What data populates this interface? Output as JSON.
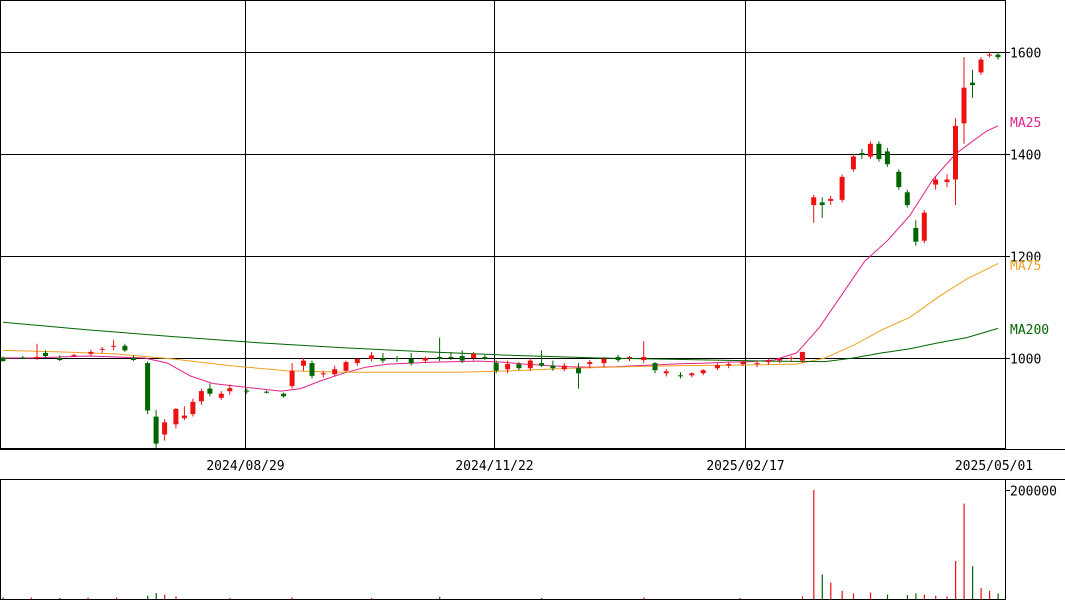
{
  "chart_data": {
    "type": "candlestick",
    "x_axis": {
      "labels": [
        "2024/08/29",
        "2024/11/22",
        "2025/02/17",
        "2025/05/01"
      ]
    },
    "price_axis": {
      "ticks": [
        1000,
        1200,
        1400,
        1600
      ],
      "range": [
        820,
        1700
      ]
    },
    "volume_axis": {
      "ticks": [
        200000
      ],
      "range": [
        0,
        210000
      ]
    },
    "moving_averages": [
      {
        "name": "MA25",
        "color": "#e0208a",
        "values": [
          [
            0,
            1000
          ],
          [
            10,
            1000
          ],
          [
            20,
            1002
          ],
          [
            30,
            1004
          ],
          [
            40,
            1002
          ],
          [
            50,
            1000
          ],
          [
            58,
            990
          ],
          [
            66,
            965
          ],
          [
            74,
            950
          ],
          [
            82,
            945
          ],
          [
            90,
            940
          ],
          [
            98,
            935
          ],
          [
            105,
            940
          ],
          [
            112,
            955
          ],
          [
            120,
            970
          ],
          [
            128,
            982
          ],
          [
            136,
            988
          ],
          [
            144,
            990
          ],
          [
            152,
            992
          ],
          [
            160,
            993
          ],
          [
            168,
            994
          ],
          [
            176,
            992
          ],
          [
            184,
            988
          ],
          [
            192,
            985
          ],
          [
            200,
            983
          ],
          [
            208,
            982
          ],
          [
            216,
            983
          ],
          [
            224,
            985
          ],
          [
            232,
            987
          ],
          [
            240,
            989
          ],
          [
            248,
            990
          ],
          [
            256,
            992
          ],
          [
            264,
            993
          ],
          [
            272,
            996
          ],
          [
            280,
            1010
          ],
          [
            288,
            1060
          ],
          [
            296,
            1125
          ],
          [
            304,
            1190
          ],
          [
            312,
            1230
          ],
          [
            320,
            1280
          ],
          [
            328,
            1350
          ],
          [
            336,
            1400
          ],
          [
            342,
            1425
          ],
          [
            347,
            1445
          ],
          [
            351,
            1455
          ]
        ]
      },
      {
        "name": "MA75",
        "color": "#f0a020",
        "values": [
          [
            0,
            1015
          ],
          [
            20,
            1012
          ],
          [
            40,
            1008
          ],
          [
            60,
            998
          ],
          [
            80,
            985
          ],
          [
            100,
            975
          ],
          [
            120,
            972
          ],
          [
            140,
            972
          ],
          [
            160,
            972
          ],
          [
            180,
            975
          ],
          [
            200,
            980
          ],
          [
            220,
            983
          ],
          [
            240,
            985
          ],
          [
            260,
            986
          ],
          [
            280,
            988
          ],
          [
            290,
            1000
          ],
          [
            300,
            1025
          ],
          [
            310,
            1055
          ],
          [
            320,
            1080
          ],
          [
            330,
            1120
          ],
          [
            340,
            1155
          ],
          [
            351,
            1185
          ]
        ]
      },
      {
        "name": "MA200",
        "color": "#006600",
        "values": [
          [
            0,
            1070
          ],
          [
            30,
            1055
          ],
          [
            60,
            1042
          ],
          [
            90,
            1030
          ],
          [
            120,
            1020
          ],
          [
            150,
            1012
          ],
          [
            180,
            1005
          ],
          [
            210,
            1000
          ],
          [
            240,
            997
          ],
          [
            270,
            994
          ],
          [
            290,
            993
          ],
          [
            300,
            1000
          ],
          [
            310,
            1010
          ],
          [
            320,
            1018
          ],
          [
            330,
            1030
          ],
          [
            340,
            1040
          ],
          [
            351,
            1058
          ]
        ]
      }
    ],
    "candles": [
      [
        0,
        1001,
        1003,
        993,
        994
      ],
      [
        7,
        1001,
        1004,
        998,
        999
      ],
      [
        12,
        1001,
        1028,
        996,
        1002
      ],
      [
        15,
        1010,
        1015,
        1000,
        1004
      ],
      [
        20,
        1000,
        1005,
        994,
        996
      ],
      [
        25,
        1004,
        1008,
        1002,
        1006
      ],
      [
        31,
        1008,
        1016,
        1004,
        1012
      ],
      [
        35,
        1016,
        1022,
        1010,
        1018
      ],
      [
        39,
        1023,
        1035,
        1015,
        1024
      ],
      [
        43,
        1024,
        1028,
        1012,
        1015
      ],
      [
        46,
        1000,
        1005,
        994,
        996
      ],
      [
        51,
        990,
        993,
        890,
        897
      ],
      [
        54,
        885,
        898,
        823,
        832
      ],
      [
        57,
        850,
        880,
        838,
        874
      ],
      [
        61,
        870,
        902,
        862,
        900
      ],
      [
        64,
        882,
        905,
        878,
        887
      ],
      [
        67,
        890,
        920,
        885,
        914
      ],
      [
        70,
        915,
        940,
        908,
        935
      ],
      [
        73,
        940,
        950,
        925,
        930
      ],
      [
        77,
        922,
        935,
        918,
        930
      ],
      [
        80,
        935,
        948,
        928,
        941
      ],
      [
        86,
        936,
        940,
        930,
        934
      ],
      [
        93,
        934,
        936,
        930,
        932
      ],
      [
        99,
        930,
        932,
        922,
        925
      ],
      [
        102,
        945,
        990,
        940,
        975
      ],
      [
        106,
        985,
        1000,
        975,
        995
      ],
      [
        109,
        990,
        995,
        960,
        965
      ],
      [
        113,
        968,
        975,
        962,
        970
      ],
      [
        117,
        968,
        985,
        965,
        978
      ],
      [
        121,
        975,
        995,
        972,
        992
      ],
      [
        125,
        990,
        1000,
        985,
        998
      ],
      [
        130,
        998,
        1012,
        994,
        1005
      ],
      [
        134,
        1000,
        1010,
        990,
        995
      ],
      [
        139,
        1000,
        1004,
        992,
        998
      ],
      [
        144,
        998,
        1010,
        985,
        990
      ],
      [
        149,
        995,
        1003,
        990,
        1000
      ],
      [
        154,
        1002,
        1040,
        994,
        998
      ],
      [
        158,
        1002,
        1012,
        996,
        1000
      ],
      [
        162,
        1004,
        1015,
        990,
        995
      ],
      [
        166,
        1000,
        1012,
        995,
        1008
      ],
      [
        170,
        1002,
        1006,
        996,
        998
      ],
      [
        174,
        990,
        995,
        970,
        975
      ],
      [
        178,
        978,
        995,
        970,
        988
      ],
      [
        182,
        988,
        992,
        976,
        980
      ],
      [
        186,
        980,
        1000,
        975,
        995
      ],
      [
        190,
        990,
        1015,
        982,
        985
      ],
      [
        194,
        985,
        995,
        975,
        980
      ],
      [
        198,
        978,
        990,
        974,
        985
      ],
      [
        203,
        980,
        990,
        940,
        970
      ],
      [
        207,
        988,
        996,
        980,
        992
      ],
      [
        212,
        990,
        1002,
        982,
        998
      ],
      [
        217,
        1002,
        1006,
        992,
        996
      ],
      [
        221,
        1000,
        1004,
        994,
        1002
      ],
      [
        226,
        996,
        1033,
        990,
        1002
      ],
      [
        230,
        990,
        992,
        970,
        976
      ],
      [
        234,
        970,
        978,
        964,
        974
      ],
      [
        239,
        966,
        972,
        960,
        964
      ],
      [
        243,
        966,
        972,
        962,
        970
      ],
      [
        247,
        970,
        978,
        966,
        976
      ],
      [
        252,
        980,
        990,
        976,
        986
      ],
      [
        256,
        985,
        992,
        980,
        988
      ],
      [
        261,
        988,
        995,
        984,
        992
      ],
      [
        266,
        988,
        994,
        982,
        990
      ],
      [
        270,
        992,
        998,
        986,
        995
      ],
      [
        274,
        995,
        1000,
        990,
        998
      ],
      [
        278,
        998,
        1004,
        992,
        1000
      ],
      [
        282,
        995,
        1012,
        990,
        1012
      ],
      [
        286,
        1300,
        1320,
        1265,
        1315
      ],
      [
        289,
        1305,
        1315,
        1275,
        1300
      ],
      [
        292,
        1308,
        1318,
        1300,
        1312
      ],
      [
        296,
        1310,
        1360,
        1305,
        1355
      ],
      [
        300,
        1370,
        1400,
        1365,
        1395
      ],
      [
        303,
        1402,
        1410,
        1390,
        1398
      ],
      [
        306,
        1395,
        1425,
        1390,
        1420
      ],
      [
        309,
        1420,
        1425,
        1385,
        1390
      ],
      [
        312,
        1405,
        1412,
        1375,
        1380
      ],
      [
        316,
        1365,
        1370,
        1330,
        1335
      ],
      [
        319,
        1325,
        1330,
        1295,
        1300
      ],
      [
        322,
        1255,
        1270,
        1220,
        1228
      ],
      [
        325,
        1230,
        1290,
        1225,
        1285
      ],
      [
        329,
        1340,
        1355,
        1330,
        1350
      ],
      [
        333,
        1345,
        1360,
        1335,
        1350
      ],
      [
        336,
        1350,
        1470,
        1300,
        1455
      ],
      [
        339,
        1460,
        1590,
        1420,
        1530
      ],
      [
        342,
        1540,
        1565,
        1510,
        1535
      ],
      [
        345,
        1560,
        1590,
        1555,
        1585
      ],
      [
        348,
        1595,
        1600,
        1590,
        1595
      ],
      [
        351,
        1595,
        1600,
        1585,
        1590
      ]
    ],
    "volumes": [
      [
        0,
        3000
      ],
      [
        10,
        2500
      ],
      [
        20,
        2000
      ],
      [
        30,
        2500
      ],
      [
        40,
        3000
      ],
      [
        51,
        6000
      ],
      [
        54,
        11000
      ],
      [
        57,
        8000
      ],
      [
        61,
        5000
      ],
      [
        80,
        2000
      ],
      [
        102,
        3000
      ],
      [
        130,
        2000
      ],
      [
        154,
        4000
      ],
      [
        190,
        2000
      ],
      [
        226,
        3000
      ],
      [
        260,
        2000
      ],
      [
        282,
        5000
      ],
      [
        286,
        200000
      ],
      [
        289,
        45000
      ],
      [
        292,
        30000
      ],
      [
        296,
        15000
      ],
      [
        300,
        10000
      ],
      [
        306,
        12000
      ],
      [
        312,
        8000
      ],
      [
        319,
        7000
      ],
      [
        322,
        10000
      ],
      [
        325,
        8000
      ],
      [
        329,
        6000
      ],
      [
        333,
        5000
      ],
      [
        336,
        70000
      ],
      [
        339,
        175000
      ],
      [
        342,
        60000
      ],
      [
        345,
        20000
      ],
      [
        348,
        15000
      ],
      [
        351,
        10000
      ]
    ]
  }
}
